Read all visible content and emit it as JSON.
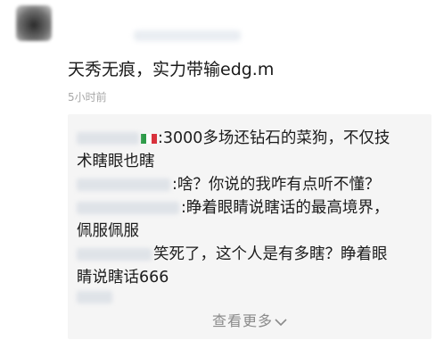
{
  "post": {
    "text": "天秀无痕，实力带输edg.m",
    "time": "5小时前"
  },
  "replies": [
    {
      "text": ":3000多场还钻石的菜狗，不仅技",
      "cont": "术瞎眼也瞎",
      "flag": "italy-flag-icon"
    },
    {
      "text": ":啥？你说的我咋有点听不懂？"
    },
    {
      "text": ":睁着眼睛说瞎话的最高境界，",
      "cont": "佩服佩服"
    },
    {
      "text": "笑死了，这个人是有多瞎？睁着眼",
      "cont": "睛说瞎话666"
    }
  ],
  "more": {
    "label": "查看更多",
    "icon": "chevron-down-icon"
  },
  "colors": {
    "thread_bg": "#f5f5f5",
    "muted": "#8a8a8a"
  }
}
